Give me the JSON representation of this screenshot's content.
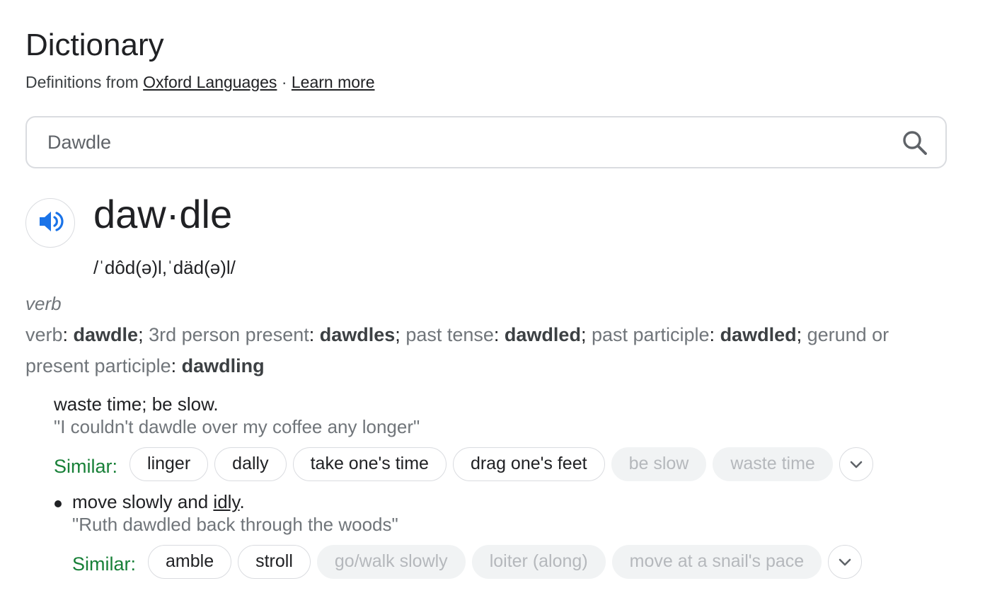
{
  "header": {
    "title": "Dictionary",
    "source_prefix": "Definitions from",
    "source_link": "Oxford Languages",
    "separator": "·",
    "learn_more": "Learn more"
  },
  "search": {
    "value": "Dawdle",
    "icon": "search-icon"
  },
  "entry": {
    "audio_icon": "speaker-icon",
    "headword": "daw·dle",
    "phonetic": "/ˈdôd(ə)l,ˈdäd(ə)l/",
    "part_of_speech": "verb",
    "forms": [
      {
        "label": "verb",
        "value": "dawdle"
      },
      {
        "label": "3rd person present",
        "value": "dawdles"
      },
      {
        "label": "past tense",
        "value": "dawdled"
      },
      {
        "label": "past participle",
        "value": "dawdled"
      },
      {
        "label": "gerund or present participle",
        "value": "dawdling"
      }
    ]
  },
  "senses": [
    {
      "definition": "waste time; be slow.",
      "example": "\"I couldn't dawdle over my coffee any longer\"",
      "similar_label": "Similar:",
      "similar": [
        {
          "label": "linger",
          "faded": false
        },
        {
          "label": "dally",
          "faded": false
        },
        {
          "label": "take one's time",
          "faded": false
        },
        {
          "label": "drag one's feet",
          "faded": false
        },
        {
          "label": "be slow",
          "faded": true
        },
        {
          "label": "waste time",
          "faded": true
        }
      ]
    },
    {
      "definition_before": "move slowly and ",
      "definition_link": "idly",
      "definition_after": ".",
      "example": "\"Ruth dawdled back through the woods\"",
      "similar_label": "Similar:",
      "similar": [
        {
          "label": "amble",
          "faded": false
        },
        {
          "label": "stroll",
          "faded": false
        },
        {
          "label": "go/walk slowly",
          "faded": true
        },
        {
          "label": "loiter (along)",
          "faded": true
        },
        {
          "label": "move at a snail's pace",
          "faded": true
        }
      ]
    }
  ],
  "expand_icon": "chevron-down-icon",
  "colors": {
    "accent_blue": "#1a73e8",
    "similar_green": "#188038",
    "muted_text": "#70757a"
  }
}
